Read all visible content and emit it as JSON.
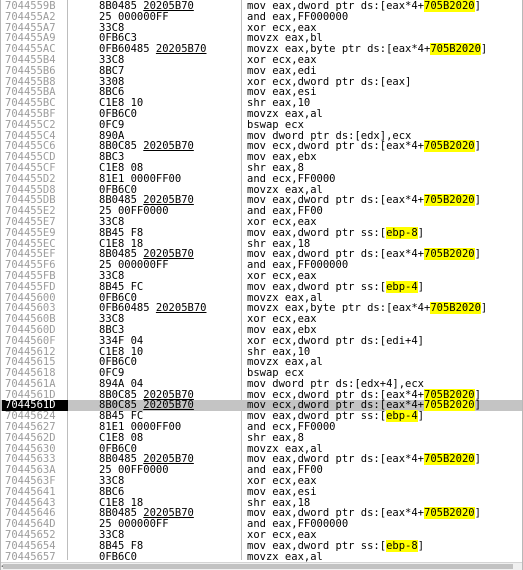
{
  "debugger": {
    "selected_index": 37,
    "scroll_arrow_glyph": "◂",
    "rows": [
      {
        "addr": "7044559B",
        "bytes": [
          {
            "t": "8B0485 "
          },
          {
            "t": "20205B70",
            "u": true
          }
        ],
        "dis": [
          {
            "t": "mov eax,dword ptr ds:[eax*4+"
          },
          {
            "t": "705B2020",
            "h": true
          },
          {
            "t": "]"
          }
        ]
      },
      {
        "addr": "704455A2",
        "bytes": [
          {
            "t": "25 000000FF"
          }
        ],
        "dis": [
          {
            "t": "and eax,FF000000"
          }
        ]
      },
      {
        "addr": "704455A7",
        "bytes": [
          {
            "t": "33C8"
          }
        ],
        "dis": [
          {
            "t": "xor ecx,eax"
          }
        ]
      },
      {
        "addr": "704455A9",
        "bytes": [
          {
            "t": "0FB6C3"
          }
        ],
        "dis": [
          {
            "t": "movzx eax,bl"
          }
        ]
      },
      {
        "addr": "704455AC",
        "bytes": [
          {
            "t": "0FB60485 "
          },
          {
            "t": "20205B70",
            "u": true
          }
        ],
        "dis": [
          {
            "t": "movzx eax,byte ptr ds:[eax*4+"
          },
          {
            "t": "705B2020",
            "h": true
          },
          {
            "t": "]"
          }
        ]
      },
      {
        "addr": "704455B4",
        "bytes": [
          {
            "t": "33C8"
          }
        ],
        "dis": [
          {
            "t": "xor ecx,eax"
          }
        ]
      },
      {
        "addr": "704455B6",
        "bytes": [
          {
            "t": "8BC7"
          }
        ],
        "dis": [
          {
            "t": "mov eax,edi"
          }
        ]
      },
      {
        "addr": "704455B8",
        "bytes": [
          {
            "t": "3308"
          }
        ],
        "dis": [
          {
            "t": "xor ecx,dword ptr ds:[eax]"
          }
        ]
      },
      {
        "addr": "704455BA",
        "bytes": [
          {
            "t": "8BC6"
          }
        ],
        "dis": [
          {
            "t": "mov eax,esi"
          }
        ]
      },
      {
        "addr": "704455BC",
        "bytes": [
          {
            "t": "C1E8 10"
          }
        ],
        "dis": [
          {
            "t": "shr eax,10"
          }
        ]
      },
      {
        "addr": "704455BF",
        "bytes": [
          {
            "t": "0FB6C0"
          }
        ],
        "dis": [
          {
            "t": "movzx eax,al"
          }
        ]
      },
      {
        "addr": "704455C2",
        "bytes": [
          {
            "t": "0FC9"
          }
        ],
        "dis": [
          {
            "t": "bswap ecx"
          }
        ]
      },
      {
        "addr": "704455C4",
        "bytes": [
          {
            "t": "890A"
          }
        ],
        "dis": [
          {
            "t": "mov dword ptr ds:[edx],ecx"
          }
        ]
      },
      {
        "addr": "704455C6",
        "bytes": [
          {
            "t": "8B0C85 "
          },
          {
            "t": "20205B70",
            "u": true
          }
        ],
        "dis": [
          {
            "t": "mov ecx,dword ptr ds:[eax*4+"
          },
          {
            "t": "705B2020",
            "h": true
          },
          {
            "t": "]"
          }
        ]
      },
      {
        "addr": "704455CD",
        "bytes": [
          {
            "t": "8BC3"
          }
        ],
        "dis": [
          {
            "t": "mov eax,ebx"
          }
        ]
      },
      {
        "addr": "704455CF",
        "bytes": [
          {
            "t": "C1E8 08"
          }
        ],
        "dis": [
          {
            "t": "shr eax,8"
          }
        ]
      },
      {
        "addr": "704455D2",
        "bytes": [
          {
            "t": "81E1 0000FF00"
          }
        ],
        "dis": [
          {
            "t": "and ecx,FF0000"
          }
        ]
      },
      {
        "addr": "704455D8",
        "bytes": [
          {
            "t": "0FB6C0"
          }
        ],
        "dis": [
          {
            "t": "movzx eax,al"
          }
        ]
      },
      {
        "addr": "704455DB",
        "bytes": [
          {
            "t": "8B0485 "
          },
          {
            "t": "20205B70",
            "u": true
          }
        ],
        "dis": [
          {
            "t": "mov eax,dword ptr ds:[eax*4+"
          },
          {
            "t": "705B2020",
            "h": true
          },
          {
            "t": "]"
          }
        ]
      },
      {
        "addr": "704455E2",
        "bytes": [
          {
            "t": "25 00FF0000"
          }
        ],
        "dis": [
          {
            "t": "and eax,FF00"
          }
        ]
      },
      {
        "addr": "704455E7",
        "bytes": [
          {
            "t": "33C8"
          }
        ],
        "dis": [
          {
            "t": "xor ecx,eax"
          }
        ]
      },
      {
        "addr": "704455E9",
        "bytes": [
          {
            "t": "8B45 F8"
          }
        ],
        "dis": [
          {
            "t": "mov eax,dword ptr ss:["
          },
          {
            "t": "ebp-8",
            "h": true
          },
          {
            "t": "]"
          }
        ]
      },
      {
        "addr": "704455EC",
        "bytes": [
          {
            "t": "C1E8 18"
          }
        ],
        "dis": [
          {
            "t": "shr eax,18"
          }
        ]
      },
      {
        "addr": "704455EF",
        "bytes": [
          {
            "t": "8B0485 "
          },
          {
            "t": "20205B70",
            "u": true
          }
        ],
        "dis": [
          {
            "t": "mov eax,dword ptr ds:[eax*4+"
          },
          {
            "t": "705B2020",
            "h": true
          },
          {
            "t": "]"
          }
        ]
      },
      {
        "addr": "704455F6",
        "bytes": [
          {
            "t": "25 000000FF"
          }
        ],
        "dis": [
          {
            "t": "and eax,FF000000"
          }
        ]
      },
      {
        "addr": "704455FB",
        "bytes": [
          {
            "t": "33C8"
          }
        ],
        "dis": [
          {
            "t": "xor ecx,eax"
          }
        ]
      },
      {
        "addr": "704455FD",
        "bytes": [
          {
            "t": "8B45 FC"
          }
        ],
        "dis": [
          {
            "t": "mov eax,dword ptr ss:["
          },
          {
            "t": "ebp-4",
            "h": true
          },
          {
            "t": "]"
          }
        ]
      },
      {
        "addr": "70445600",
        "bytes": [
          {
            "t": "0FB6C0"
          }
        ],
        "dis": [
          {
            "t": "movzx eax,al"
          }
        ]
      },
      {
        "addr": "70445603",
        "bytes": [
          {
            "t": "0FB60485 "
          },
          {
            "t": "20205B70",
            "u": true
          }
        ],
        "dis": [
          {
            "t": "movzx eax,byte ptr ds:[eax*4+"
          },
          {
            "t": "705B2020",
            "h": true
          },
          {
            "t": "]"
          }
        ]
      },
      {
        "addr": "7044560B",
        "bytes": [
          {
            "t": "33C8"
          }
        ],
        "dis": [
          {
            "t": "xor ecx,eax"
          }
        ]
      },
      {
        "addr": "7044560D",
        "bytes": [
          {
            "t": "8BC3"
          }
        ],
        "dis": [
          {
            "t": "mov eax,ebx"
          }
        ]
      },
      {
        "addr": "7044560F",
        "bytes": [
          {
            "t": "334F 04"
          }
        ],
        "dis": [
          {
            "t": "xor ecx,dword ptr ds:[edi+4]"
          }
        ]
      },
      {
        "addr": "70445612",
        "bytes": [
          {
            "t": "C1E8 10"
          }
        ],
        "dis": [
          {
            "t": "shr eax,10"
          }
        ]
      },
      {
        "addr": "70445615",
        "bytes": [
          {
            "t": "0FB6C0"
          }
        ],
        "dis": [
          {
            "t": "movzx eax,al"
          }
        ]
      },
      {
        "addr": "70445618",
        "bytes": [
          {
            "t": "0FC9"
          }
        ],
        "dis": [
          {
            "t": "bswap ecx"
          }
        ]
      },
      {
        "addr": "7044561A",
        "bytes": [
          {
            "t": "894A 04"
          }
        ],
        "dis": [
          {
            "t": "mov dword ptr ds:[edx+4],ecx"
          }
        ]
      },
      {
        "addr": "7044561D",
        "bytes": [
          {
            "t": "8B0C85 "
          },
          {
            "t": "20205B70",
            "u": true
          }
        ],
        "dis": [
          {
            "t": "mov ecx,dword ptr ds:[eax*4+"
          },
          {
            "t": "705B2020",
            "h": true
          },
          {
            "t": "]"
          }
        ]
      },
      {
        "addr": "7044561D",
        "bytes": [
          {
            "t": "8B0C85 "
          },
          {
            "t": "20205B70",
            "u": true
          }
        ],
        "dis": [
          {
            "t": "mov ecx,dword ptr ds:[eax*4+"
          },
          {
            "t": "705B2020",
            "h": true
          },
          {
            "t": "]"
          }
        ]
      },
      {
        "addr": "70445624",
        "bytes": [
          {
            "t": "8B45 FC"
          }
        ],
        "dis": [
          {
            "t": "mov eax,dword ptr ss:["
          },
          {
            "t": "ebp-4",
            "h": true
          },
          {
            "t": "]"
          }
        ]
      },
      {
        "addr": "70445627",
        "bytes": [
          {
            "t": "81E1 0000FF00"
          }
        ],
        "dis": [
          {
            "t": "and ecx,FF0000"
          }
        ]
      },
      {
        "addr": "7044562D",
        "bytes": [
          {
            "t": "C1E8 08"
          }
        ],
        "dis": [
          {
            "t": "shr eax,8"
          }
        ]
      },
      {
        "addr": "70445630",
        "bytes": [
          {
            "t": "0FB6C0"
          }
        ],
        "dis": [
          {
            "t": "movzx eax,al"
          }
        ]
      },
      {
        "addr": "70445633",
        "bytes": [
          {
            "t": "8B0485 "
          },
          {
            "t": "20205B70",
            "u": true
          }
        ],
        "dis": [
          {
            "t": "mov eax,dword ptr ds:[eax*4+"
          },
          {
            "t": "705B2020",
            "h": true
          },
          {
            "t": "]"
          }
        ]
      },
      {
        "addr": "7044563A",
        "bytes": [
          {
            "t": "25 00FF0000"
          }
        ],
        "dis": [
          {
            "t": "and eax,FF00"
          }
        ]
      },
      {
        "addr": "7044563F",
        "bytes": [
          {
            "t": "33C8"
          }
        ],
        "dis": [
          {
            "t": "xor ecx,eax"
          }
        ]
      },
      {
        "addr": "70445641",
        "bytes": [
          {
            "t": "8BC6"
          }
        ],
        "dis": [
          {
            "t": "mov eax,esi"
          }
        ]
      },
      {
        "addr": "70445643",
        "bytes": [
          {
            "t": "C1E8 18"
          }
        ],
        "dis": [
          {
            "t": "shr eax,18"
          }
        ]
      },
      {
        "addr": "70445646",
        "bytes": [
          {
            "t": "8B0485 "
          },
          {
            "t": "20205B70",
            "u": true
          }
        ],
        "dis": [
          {
            "t": "mov eax,dword ptr ds:[eax*4+"
          },
          {
            "t": "705B2020",
            "h": true
          },
          {
            "t": "]"
          }
        ]
      },
      {
        "addr": "7044564D",
        "bytes": [
          {
            "t": "25 000000FF"
          }
        ],
        "dis": [
          {
            "t": "and eax,FF000000"
          }
        ]
      },
      {
        "addr": "70445652",
        "bytes": [
          {
            "t": "33C8"
          }
        ],
        "dis": [
          {
            "t": "xor ecx,eax"
          }
        ]
      },
      {
        "addr": "70445654",
        "bytes": [
          {
            "t": "8B45 F8"
          }
        ],
        "dis": [
          {
            "t": "mov eax,dword ptr ss:["
          },
          {
            "t": "ebp-8",
            "h": true
          },
          {
            "t": "]"
          }
        ]
      },
      {
        "addr": "70445657",
        "bytes": [
          {
            "t": "0FB6C0"
          }
        ],
        "dis": [
          {
            "t": "movzx eax,al"
          }
        ]
      }
    ]
  }
}
